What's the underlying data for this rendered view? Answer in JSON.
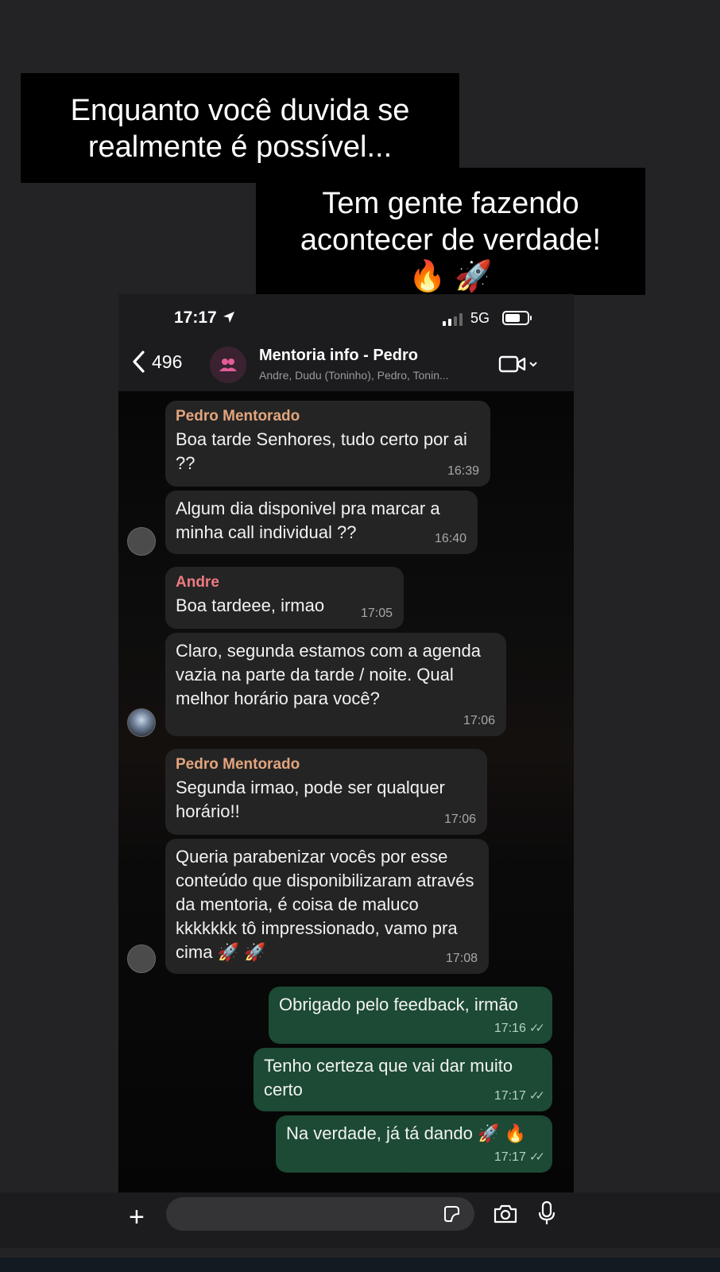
{
  "captions": {
    "line1": "Enquanto você duvida se realmente é possível...",
    "line2": "Tem gente fazendo acontecer de verdade! 🔥 🚀"
  },
  "status_bar": {
    "time": "17:17",
    "network": "5G",
    "icons": [
      "location-arrow-icon",
      "signal-icon",
      "battery-icon"
    ]
  },
  "chat_header": {
    "back_count": "496",
    "title": "Mentoria info - Pedro",
    "members": "Andre, Dudu (Toninho), Pedro, Tonin...",
    "icons": [
      "chevron-left-icon",
      "group-icon",
      "video-call-icon",
      "chevron-down-icon"
    ]
  },
  "messages": [
    {
      "sender": "Pedro Mentorado",
      "text": "Boa tarde Senhores, tudo certo por ai ??",
      "time": "16:39",
      "direction": "in"
    },
    {
      "text": "Algum dia disponivel pra marcar a minha call individual ??",
      "time": "16:40",
      "direction": "in"
    },
    {
      "sender": "Andre",
      "text": "Boa tardeee, irmao",
      "time": "17:05",
      "direction": "in"
    },
    {
      "text": "Claro, segunda estamos com a agenda vazia na parte da tarde / noite. Qual melhor horário para você?",
      "time": "17:06",
      "direction": "in"
    },
    {
      "sender": "Pedro Mentorado",
      "text": "Segunda irmao, pode ser qualquer horário!!",
      "time": "17:06",
      "direction": "in"
    },
    {
      "text": "Queria parabenizar vocês por esse conteúdo que disponibilizaram através da mentoria, é coisa de maluco kkkkkkk tô impressionado, vamo pra cima 🚀 🚀",
      "time": "17:08",
      "direction": "in"
    },
    {
      "text": "Obrigado pelo feedback, irmão",
      "time": "17:16",
      "direction": "out"
    },
    {
      "text": "Tenho certeza que vai dar muito certo",
      "time": "17:17",
      "direction": "out"
    },
    {
      "text": "Na verdade, já tá dando 🚀 🔥",
      "time": "17:17",
      "direction": "out"
    }
  ],
  "composer": {
    "placeholder": "",
    "icons": [
      "plus-icon",
      "sticker-icon",
      "camera-icon",
      "microphone-icon"
    ]
  },
  "colors": {
    "incoming_bubble": "#242424",
    "outgoing_bubble": "#1c4a34",
    "sender_pedro": "#e3a57e",
    "sender_andre": "#ef7a80"
  }
}
